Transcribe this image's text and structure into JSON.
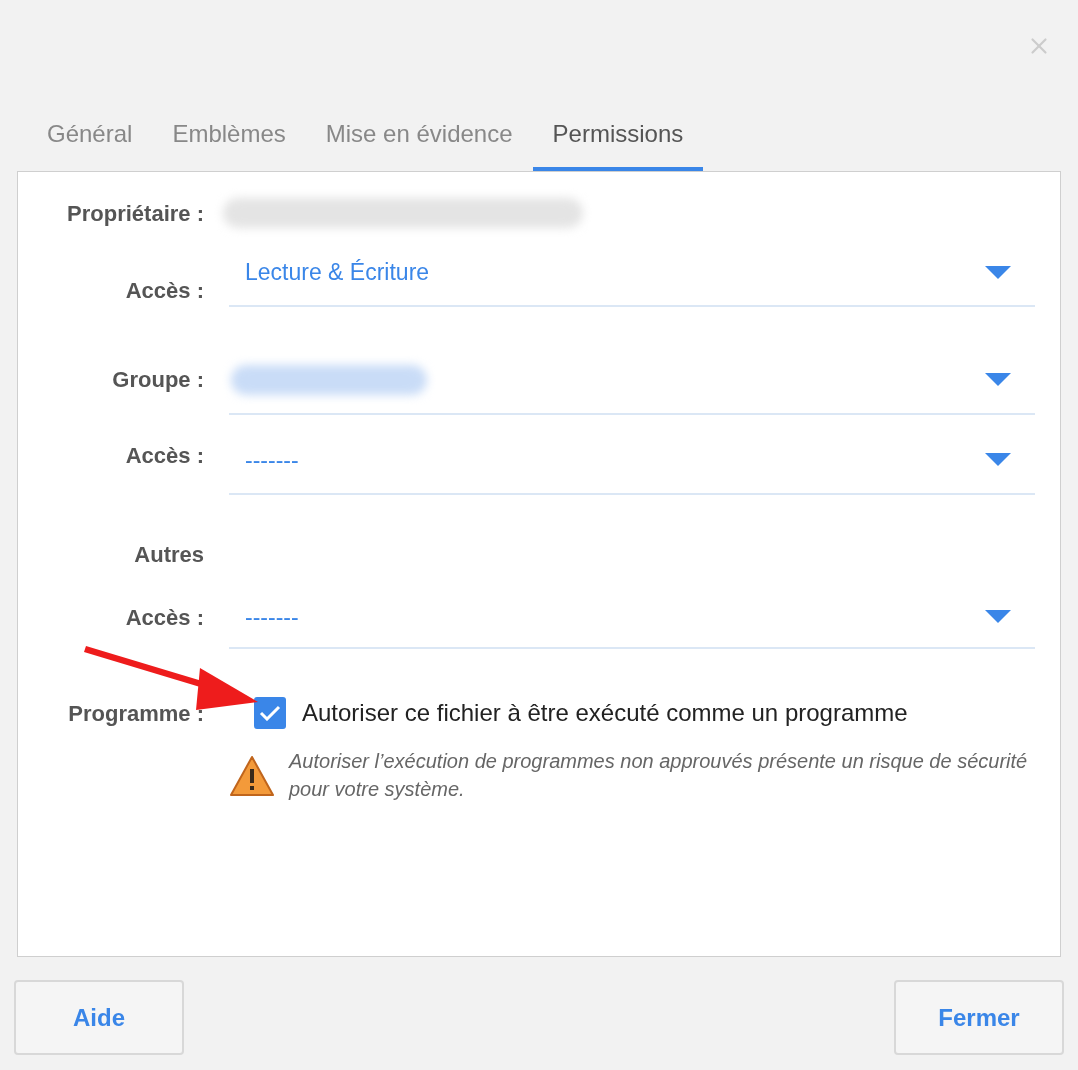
{
  "tabs": [
    {
      "label": "Général",
      "selected": false
    },
    {
      "label": "Emblèmes",
      "selected": false
    },
    {
      "label": "Mise en évidence",
      "selected": false
    },
    {
      "label": "Permissions",
      "selected": true
    }
  ],
  "owner": {
    "label": "Propriétaire :",
    "redacted": true
  },
  "owner_access": {
    "label": "Accès :",
    "value": "Lecture & Écriture"
  },
  "group": {
    "label": "Groupe :",
    "redacted": true
  },
  "group_access": {
    "label": "Accès :",
    "value": "-------"
  },
  "others": {
    "label": "Autres"
  },
  "others_access": {
    "label": "Accès :",
    "value": "-------"
  },
  "program": {
    "label": "Programme :",
    "checkbox_label": "Autoriser ce fichier à être exécuté comme un programme",
    "checked": true,
    "warning": "Autoriser l’exécution de programmes non approuvés présente un risque de sécurité pour votre système."
  },
  "buttons": [
    {
      "label": "Aide"
    },
    {
      "label": "Fermer"
    }
  ]
}
